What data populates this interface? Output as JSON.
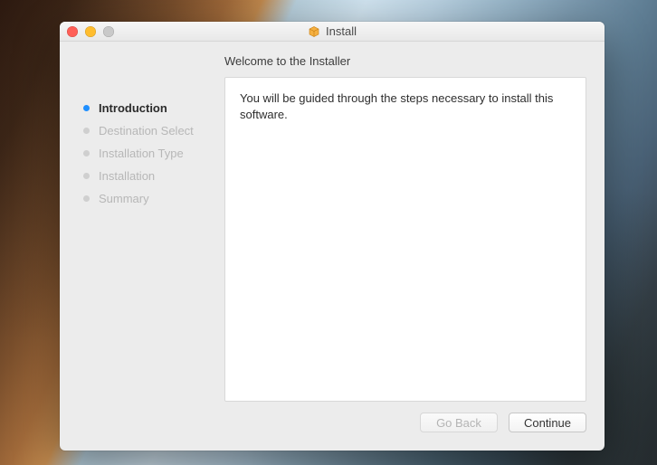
{
  "window": {
    "title": "Install"
  },
  "header": {
    "welcome_text": "Welcome to the  Installer"
  },
  "sidebar": {
    "steps": [
      {
        "label": "Introduction",
        "active": true
      },
      {
        "label": "Destination Select",
        "active": false
      },
      {
        "label": "Installation Type",
        "active": false
      },
      {
        "label": "Installation",
        "active": false
      },
      {
        "label": "Summary",
        "active": false
      }
    ]
  },
  "content": {
    "body_text": "You will be guided through the steps necessary to install this software."
  },
  "footer": {
    "go_back_label": "Go Back",
    "continue_label": "Continue",
    "go_back_enabled": false,
    "continue_enabled": true
  },
  "colors": {
    "accent": "#1f8fff"
  }
}
